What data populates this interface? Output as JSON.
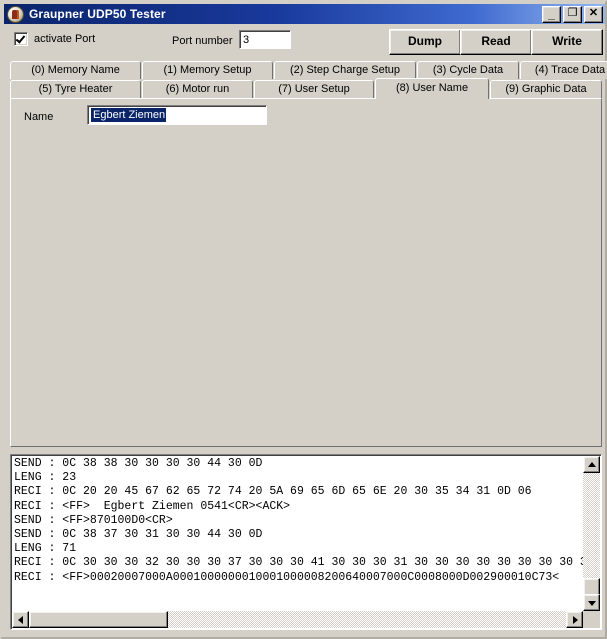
{
  "window": {
    "title": "Graupner UDP50 Tester",
    "icon": "app-icon",
    "caption_buttons": {
      "minimize": "_",
      "maximize": "❐",
      "close": "✕"
    }
  },
  "toolbar": {
    "activate_port_label": "activate Port",
    "activate_port_checked": true,
    "port_number_label": "Port number",
    "port_number_value": "3",
    "dump_label": "Dump",
    "read_label": "Read",
    "write_label": "Write"
  },
  "tabs": {
    "row0": [
      {
        "label": "(0) Memory Name",
        "active": false
      },
      {
        "label": "(1) Memory Setup",
        "active": false
      },
      {
        "label": "(2) Step Charge Setup",
        "active": false
      },
      {
        "label": "(3) Cycle Data",
        "active": false
      },
      {
        "label": "(4) Trace Data",
        "active": false
      }
    ],
    "row1": [
      {
        "label": "(5) Tyre Heater",
        "active": false
      },
      {
        "label": "(6) Motor run",
        "active": false
      },
      {
        "label": "(7) User Setup",
        "active": false
      },
      {
        "label": "(8) User Name",
        "active": true
      },
      {
        "label": "(9) Graphic Data",
        "active": false
      }
    ]
  },
  "content": {
    "name_label": "Name",
    "name_value": "Egbert Ziemen",
    "name_selected": true
  },
  "log": {
    "lines": [
      "SEND : 0C 38 38 30 30 30 30 44 30 0D",
      "LENG : 23",
      "RECI : 0C 20 20 45 67 62 65 72 74 20 5A 69 65 6D 65 6E 20 30 35 34 31 0D 06",
      "RECI : <FF>  Egbert Ziemen 0541<CR><ACK>",
      "SEND : <FF>870100D0<CR>",
      "SEND : 0C 38 37 30 31 30 30 44 30 0D",
      "LENG : 71",
      "RECI : 0C 30 30 30 32 30 30 30 37 30 30 30 41 30 30 30 31 30 30 30 30 30 30 30 30 3",
      "RECI : <FF>00020007000A0001000000010001000008200640007000C0008000D002900010C73<"
    ]
  },
  "colors": {
    "window_face": "#d4d0c8",
    "titlebar_start": "#0a246a",
    "titlebar_end": "#94b7ef",
    "selection": "#0a246a",
    "log_background": "#ffffff",
    "text": "#000000"
  }
}
